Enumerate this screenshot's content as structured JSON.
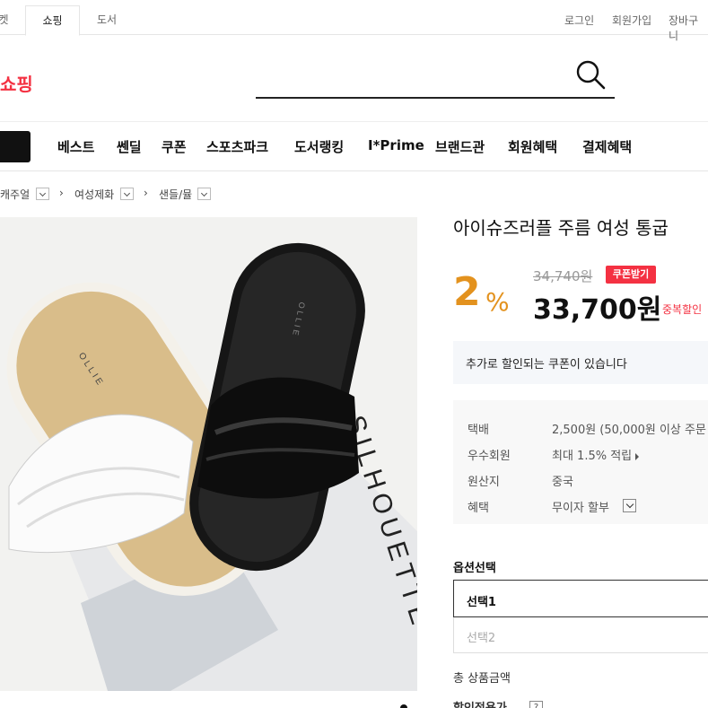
{
  "top_tabs": [
    "켓",
    "쇼핑",
    "도서"
  ],
  "util_links": [
    "로그인",
    "회원가입",
    "장바구니"
  ],
  "logo_text": "쇼핑",
  "nav": [
    "베스트",
    "쎈딜",
    "쿠폰",
    "스포츠파크",
    "도서랭킹",
    "I*Prime",
    "브랜드관",
    "회원혜택",
    "결제혜택"
  ],
  "breadcrumb": [
    "캐주얼",
    "여성제화",
    "샌들/뮬"
  ],
  "product": {
    "title": "아이슈즈러플 주름 여성 통굽",
    "discount_rate": "2",
    "discount_unit": "%",
    "original_price": "34,740원",
    "coupon_badge": "쿠폰받기",
    "sale_price": "33,700원",
    "duplicate_discount": "중복할인",
    "image_text": "OLLIE",
    "image_text_2": "SILHOUETTE"
  },
  "coupon_notice": "추가로 할인되는 쿠폰이 있습니다",
  "info": {
    "shipping_label": "택배",
    "shipping_value": "2,500원 (50,000원 이상 주문",
    "member_label": "우수회원",
    "member_value": "최대 1.5% 적립",
    "origin_label": "원산지",
    "origin_value": "중국",
    "benefit_label": "혜택",
    "benefit_value": "무이자 할부"
  },
  "options": {
    "label": "옵션선택",
    "select1": "선택1",
    "select2": "선택2"
  },
  "total_label": "총 상품금액",
  "discount_applied_label": "할인적용가",
  "colors": {
    "accent_red": "#f43142",
    "discount_orange": "#e3921e"
  }
}
